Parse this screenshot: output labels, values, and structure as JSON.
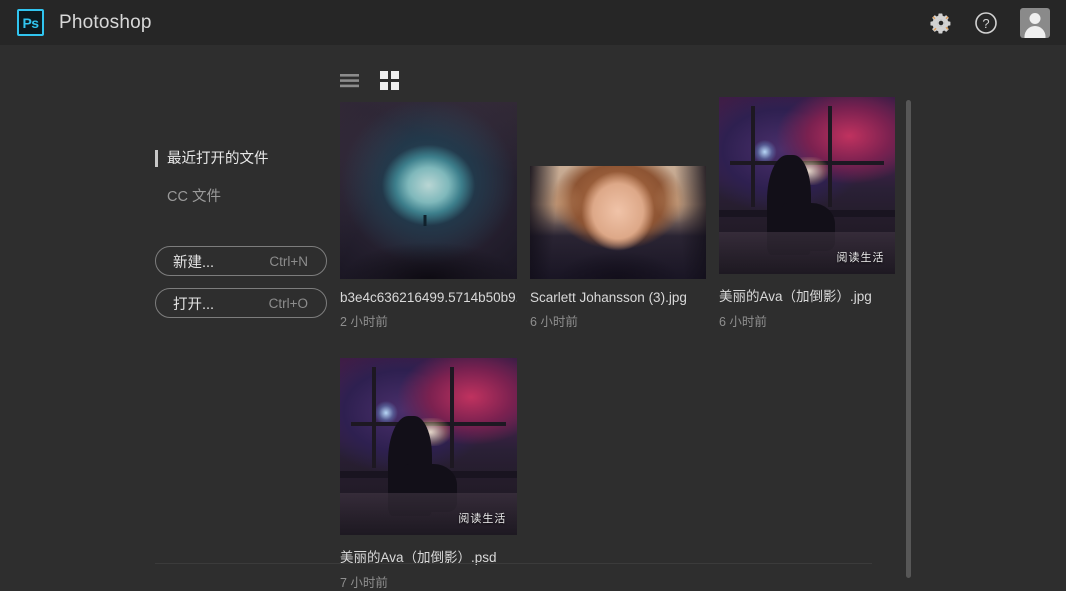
{
  "header": {
    "logo_text": "Ps",
    "title": "Photoshop",
    "settings_icon": "gear-icon",
    "help_icon": "question-mark-icon",
    "avatar_icon": "user-avatar-icon"
  },
  "sidebar": {
    "nav": [
      {
        "label": "最近打开的文件",
        "active": true
      },
      {
        "label": "CC 文件",
        "active": false
      }
    ],
    "buttons": [
      {
        "label": "新建...",
        "shortcut": "Ctrl+N"
      },
      {
        "label": "打开...",
        "shortcut": "Ctrl+O"
      }
    ]
  },
  "view_toggle": {
    "list_label": "list-view",
    "grid_label": "grid-view",
    "active": "grid-view"
  },
  "files": [
    {
      "name": "b3e4c636216499.5714b50b9...",
      "time": "2 小时前",
      "art": "cave",
      "watermark": ""
    },
    {
      "name": "Scarlett Johansson (3).jpg",
      "time": "6 小时前",
      "art": "portrait",
      "watermark": ""
    },
    {
      "name": "美丽的Ava（加倒影）.jpg",
      "time": "6 小时前",
      "art": "window",
      "watermark": "阅读生活"
    },
    {
      "name": "美丽的Ava（加倒影）.psd",
      "time": "7 小时前",
      "art": "window",
      "watermark": "阅读生活"
    }
  ],
  "colors": {
    "header_bg": "#262626",
    "body_bg": "#2e2e2e",
    "accent": "#31c5f0",
    "text_primary": "#d9d9d9",
    "text_muted": "#8e8e8e"
  }
}
